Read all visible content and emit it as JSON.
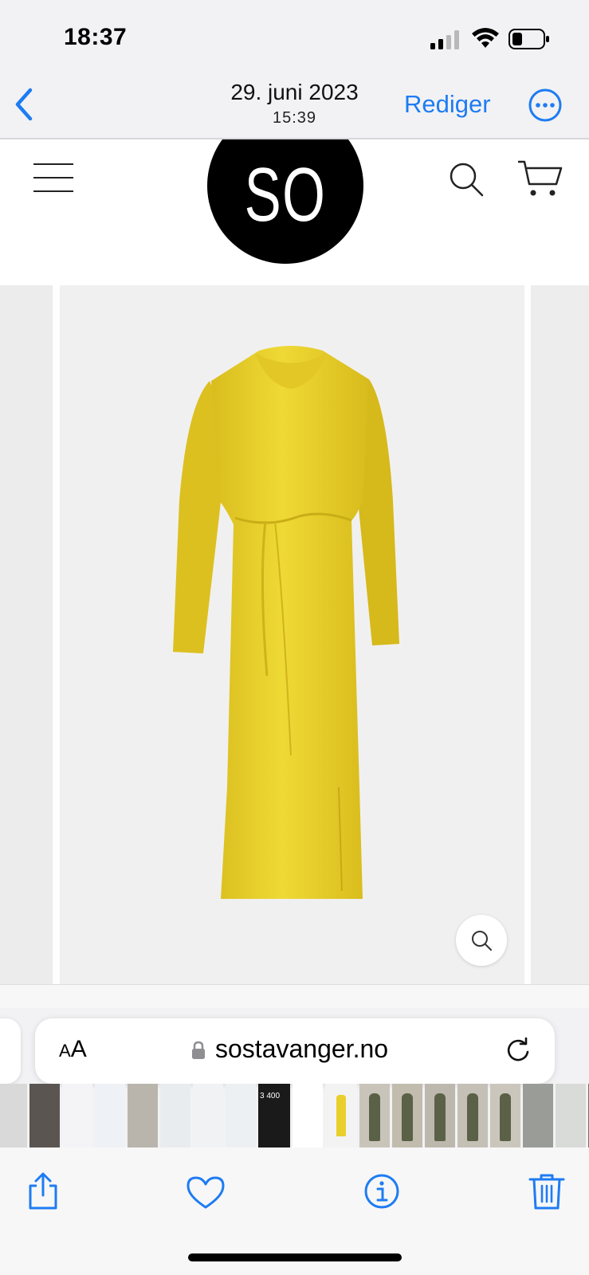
{
  "status_bar": {
    "time": "18:37",
    "icons": [
      "cellular-signal-icon",
      "wifi-icon",
      "battery-icon"
    ]
  },
  "nav": {
    "back_icon": "chevron-left-icon",
    "date": "29. juni 2023",
    "time": "15:39",
    "edit_label": "Rediger",
    "more_icon": "ellipsis-circle-icon",
    "accent_color": "#1e7cf2"
  },
  "website": {
    "logo_text": "SO",
    "menu_icon": "hamburger-menu-icon",
    "search_icon": "search-icon",
    "cart_icon": "shopping-cart-icon",
    "product_image": "yellow-satin-long-sleeve-dress",
    "product_color": "#e8cf2c",
    "zoom_icon": "magnifier-icon"
  },
  "address_bar": {
    "text_size_label": "AA",
    "url": "sostavanger.no",
    "lock_icon": "lock-icon",
    "reload_icon": "reload-icon"
  },
  "thumbnails": [
    {
      "kind": "kitchen",
      "bg": "#d9d9d9"
    },
    {
      "kind": "dark",
      "bg": "#5a5550"
    },
    {
      "kind": "document",
      "bg": "#f4f4f6"
    },
    {
      "kind": "document",
      "bg": "#eef1f5"
    },
    {
      "kind": "photo",
      "bg": "#b9b5ad"
    },
    {
      "kind": "document",
      "bg": "#e9ecef"
    },
    {
      "kind": "document",
      "bg": "#f1f2f4"
    },
    {
      "kind": "document",
      "bg": "#edf0f3"
    },
    {
      "kind": "calculator",
      "bg": "#1a1a1a",
      "text": "3 400"
    },
    {
      "kind": "document",
      "bg": "#ffffff"
    },
    {
      "kind": "dress",
      "bg": "#f3f3f3"
    },
    {
      "kind": "people",
      "bg": "#c9c4b9"
    },
    {
      "kind": "people",
      "bg": "#c2bcae"
    },
    {
      "kind": "people",
      "bg": "#bdb8ad"
    },
    {
      "kind": "people",
      "bg": "#c5c0b6"
    },
    {
      "kind": "people",
      "bg": "#cbc6bc"
    },
    {
      "kind": "room",
      "bg": "#9a9c98"
    },
    {
      "kind": "room",
      "bg": "#d8dbd7"
    },
    {
      "kind": "people",
      "bg": "#6f7268"
    },
    {
      "kind": "room",
      "bg": "#dfe2e0"
    }
  ],
  "toolbar": {
    "icons": [
      "share-icon",
      "heart-icon",
      "info-icon",
      "trash-icon"
    ]
  }
}
